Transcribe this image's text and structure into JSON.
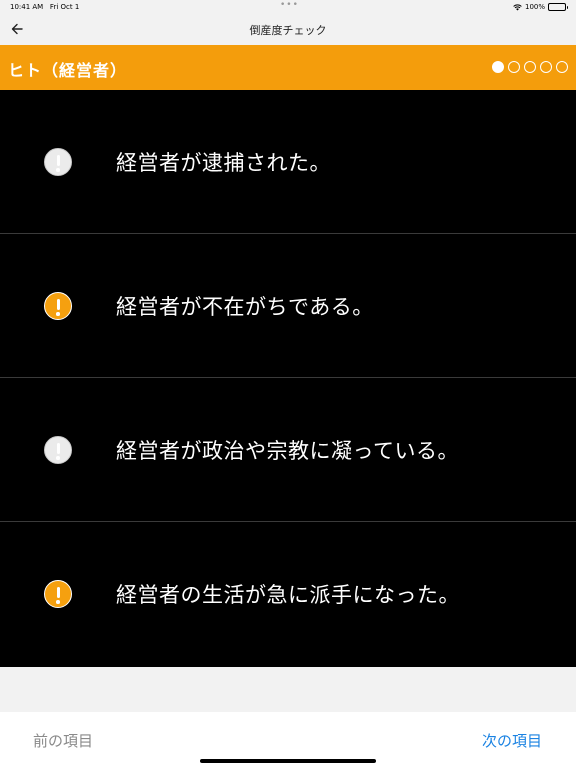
{
  "status": {
    "time": "10:41 AM",
    "date": "Fri Oct 1",
    "battery": "100%"
  },
  "nav": {
    "title": "倒産度チェック"
  },
  "section": {
    "title": "ヒト（経営者）",
    "dots": [
      true,
      false,
      false,
      false,
      false
    ]
  },
  "items": [
    {
      "text": "経営者が逮捕された。",
      "state": "off"
    },
    {
      "text": "経営者が不在がちである。",
      "state": "on"
    },
    {
      "text": "経営者が政治や宗教に凝っている。",
      "state": "off"
    },
    {
      "text": "経営者の生活が急に派手になった。",
      "state": "on"
    }
  ],
  "toolbar": {
    "prev_label": "前の項目",
    "next_label": "次の項目"
  },
  "colors": {
    "accent": "#f49d0c",
    "link": "#1a82e2"
  },
  "icons": {
    "back": "back-arrow-icon",
    "alert": "exclamation-circle-icon",
    "wifi": "wifi-icon",
    "battery": "battery-icon"
  }
}
